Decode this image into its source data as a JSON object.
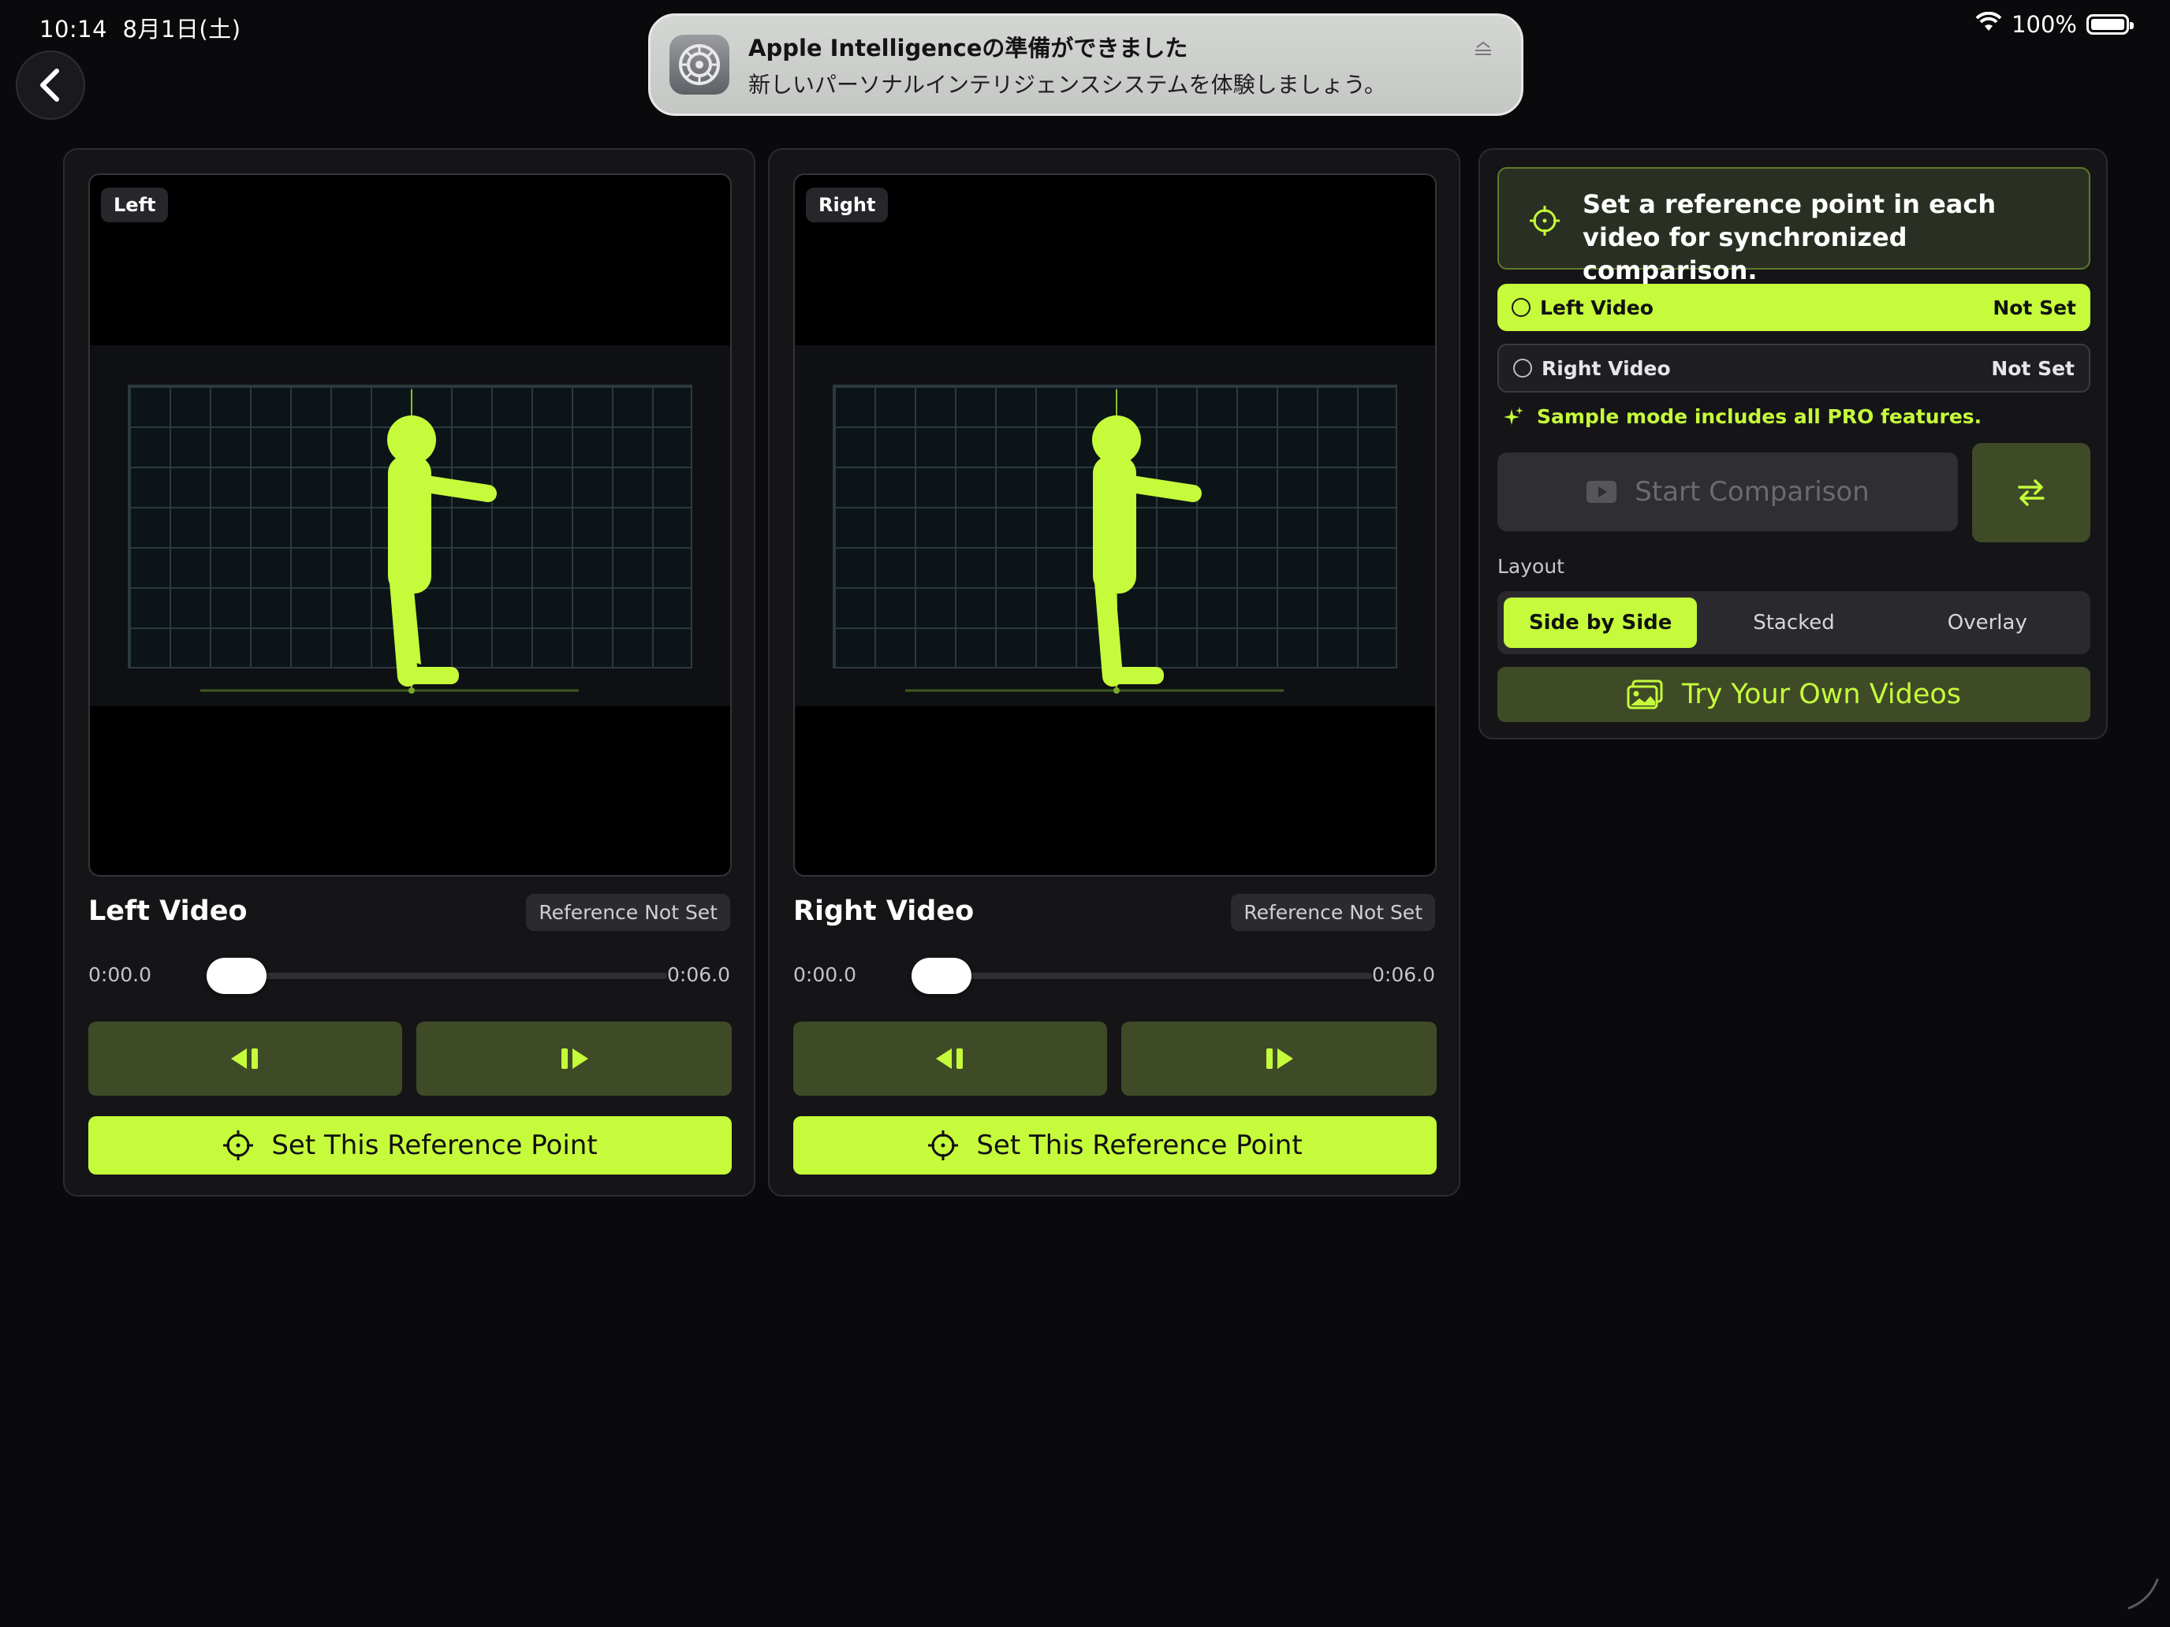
{
  "status_bar": {
    "time": "10:14",
    "date": "8月1日(土)",
    "battery": "100%",
    "wifi_icon": "wifi-icon",
    "battery_icon": "battery-icon"
  },
  "navigation": {
    "back_icon": "chevron-left-icon"
  },
  "notification": {
    "app_icon": "settings-gear-icon",
    "title": "Apple Intelligenceの準備ができました",
    "body": "新しいパーソナルインテリジェンスシステムを体験しましょう。"
  },
  "left_panel": {
    "tag": "Left",
    "title": "Left Video",
    "reference_status": "Reference Not Set",
    "time_start": "0:00.0",
    "time_end": "0:06.0",
    "progress": 0,
    "set_reference_label": "Set This Reference Point"
  },
  "right_panel": {
    "tag": "Right",
    "title": "Right Video",
    "reference_status": "Reference Not Set",
    "time_start": "0:00.0",
    "time_end": "0:06.0",
    "progress": 0,
    "set_reference_label": "Set This Reference Point"
  },
  "controls": {
    "hint": "Set a reference point in each video for synchronized comparison.",
    "rows": [
      {
        "label": "Left Video",
        "status": "Not Set"
      },
      {
        "label": "Right Video",
        "status": "Not Set"
      }
    ],
    "sample_note": "Sample mode includes all PRO features.",
    "start_label": "Start Comparison",
    "layout_label": "Layout",
    "layout_options": [
      "Side by Side",
      "Stacked",
      "Overlay"
    ],
    "layout_selected": "Side by Side",
    "try_label": "Try Your Own Videos"
  },
  "colors": {
    "accent": "#c5fb3b",
    "accent_dark": "#3f4b27",
    "background": "#0a0a0c",
    "panel": "#151518"
  }
}
